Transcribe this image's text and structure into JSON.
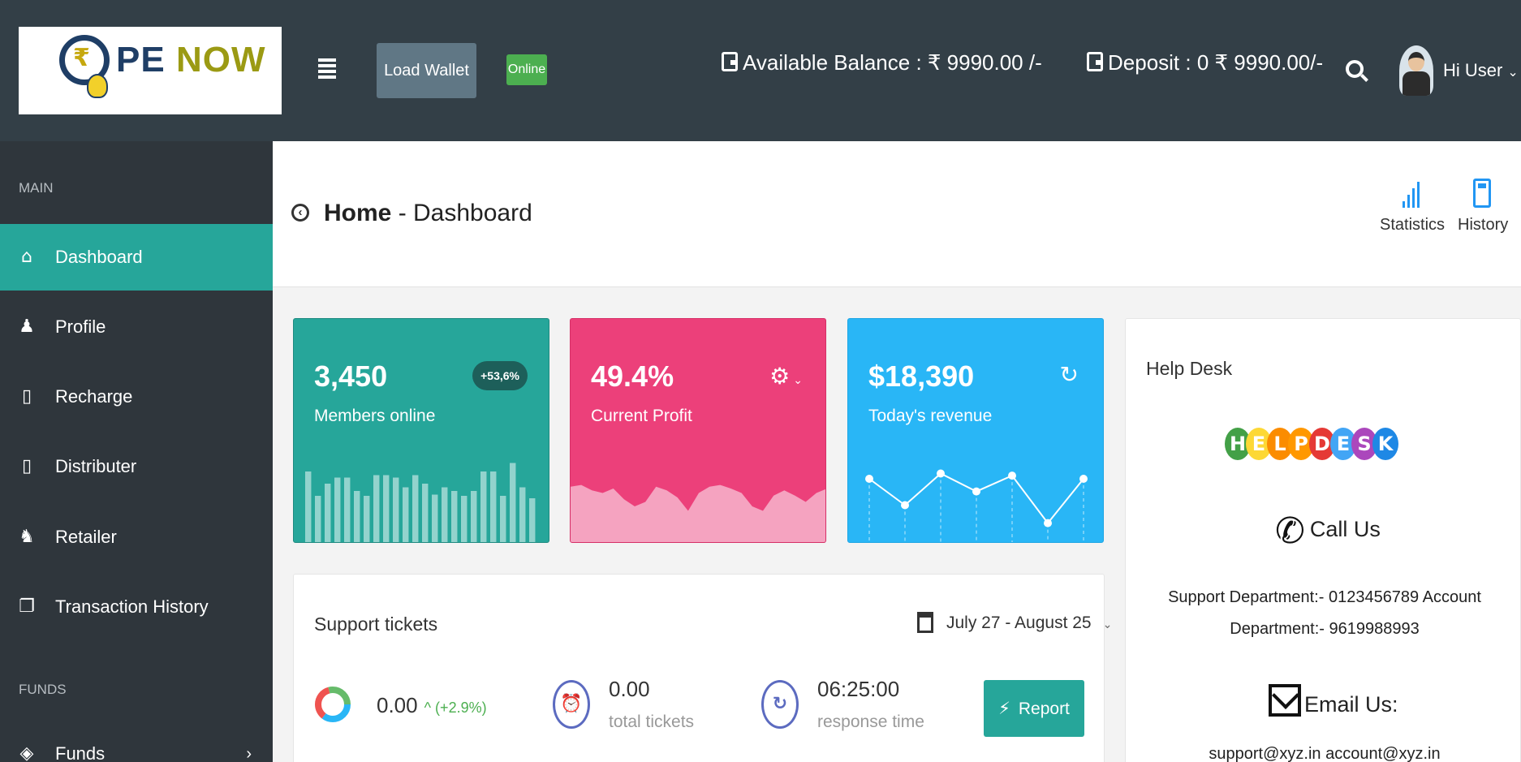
{
  "brand": {
    "logo_rupee": "₹",
    "logo_text_1": "PE",
    "logo_text_2": "NOW"
  },
  "topbar": {
    "load_wallet_label": "Load Wallet",
    "status_badge": "Online",
    "available_balance": "Available Balance : ₹ 9990.00 /-",
    "deposit": "Deposit : 0 ₹ 9990.00/-",
    "user_greeting": "Hi User",
    "user_chevron": "⌄"
  },
  "sidebar": {
    "section_main": "MAIN",
    "section_funds": "FUNDS",
    "items": [
      {
        "label": "Dashboard",
        "icon": "⌂"
      },
      {
        "label": "Profile",
        "icon": "♟"
      },
      {
        "label": "Recharge",
        "icon": "▯"
      },
      {
        "label": "Distributer",
        "icon": "▯"
      },
      {
        "label": "Retailer",
        "icon": "♞"
      },
      {
        "label": "Transaction History",
        "icon": "❐"
      },
      {
        "label": "Funds",
        "icon": "◈",
        "arrow": "›"
      }
    ]
  },
  "header": {
    "back_icon": "‹",
    "title_home": "Home",
    "title_rest": " - Dashboard",
    "statistics_label": "Statistics",
    "history_label": "History"
  },
  "cards": [
    {
      "value": "3,450",
      "label": "Members online",
      "badge": "+53,6%",
      "color": "#26a69a"
    },
    {
      "value": "49.4%",
      "label": "Current Profit",
      "icon": "⚙",
      "chevron": "⌄",
      "color": "#ec407a"
    },
    {
      "value": "$18,390",
      "label": "Today's revenue",
      "icon": "↻",
      "color": "#29b6f6"
    }
  ],
  "members_bars": [
    0.58,
    0.38,
    0.48,
    0.53,
    0.53,
    0.42,
    0.38,
    0.55,
    0.55,
    0.53,
    0.45,
    0.55,
    0.48,
    0.39,
    0.45,
    0.42,
    0.38,
    0.42,
    0.58,
    0.58,
    0.38,
    0.65,
    0.45,
    0.36
  ],
  "profit_wave": [
    0.62,
    0.64,
    0.58,
    0.55,
    0.6,
    0.48,
    0.4,
    0.45,
    0.62,
    0.58,
    0.5,
    0.35,
    0.55,
    0.62,
    0.64,
    0.6,
    0.55,
    0.4,
    0.35,
    0.52,
    0.58,
    0.52,
    0.45,
    0.55,
    0.6
  ],
  "revenue_points": [
    0.6,
    0.35,
    0.65,
    0.48,
    0.63,
    0.18,
    0.6
  ],
  "tickets": {
    "title": "Support tickets",
    "date_range": "July 27 - August 25",
    "chevron": "⌄",
    "stat1_value": "0.00",
    "stat1_growth": "^ (+2.9%)",
    "stat2_icon": "⏰",
    "stat2_value": "0.00",
    "stat2_label": "total tickets",
    "stat3_icon": "↻",
    "stat3_value": "06:25:00",
    "stat3_label": "response time",
    "report_icon": "⚡",
    "report_label": "Report"
  },
  "helpdesk": {
    "title": "Help Desk",
    "logo_letters": [
      "H",
      "E",
      "L",
      "P",
      "D",
      "E",
      "S",
      "K"
    ],
    "logo_colors": [
      "#43a047",
      "#fdd835",
      "#fb8c00",
      "#ff9800",
      "#e53935",
      "#42a5f5",
      "#ab47bc",
      "#1e88e5"
    ],
    "phone_icon": "✆",
    "call_label": "Call Us",
    "support_text": "Support Department:- 0123456789 Account Department:- 9619988993",
    "email_label": "Email Us:",
    "email_text": "support@xyz.in account@xyz.in"
  }
}
